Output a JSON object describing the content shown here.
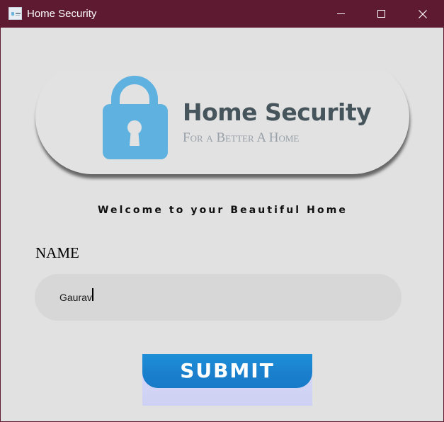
{
  "window": {
    "title": "Home Security",
    "titlebar_color": "#5e1a31",
    "controls": [
      "minimize-icon",
      "maximize-icon",
      "close-icon"
    ]
  },
  "banner": {
    "brand_name": "Home Security",
    "tagline": "For a Better A Home",
    "lock_color": "#5fb2e0"
  },
  "welcome_text": "Welcome to your Beautiful Home",
  "form": {
    "name_label": "NAME",
    "name_value": "Gaurav",
    "submit_label": "SUBMIT",
    "submit_color": "#1a7fcc"
  }
}
